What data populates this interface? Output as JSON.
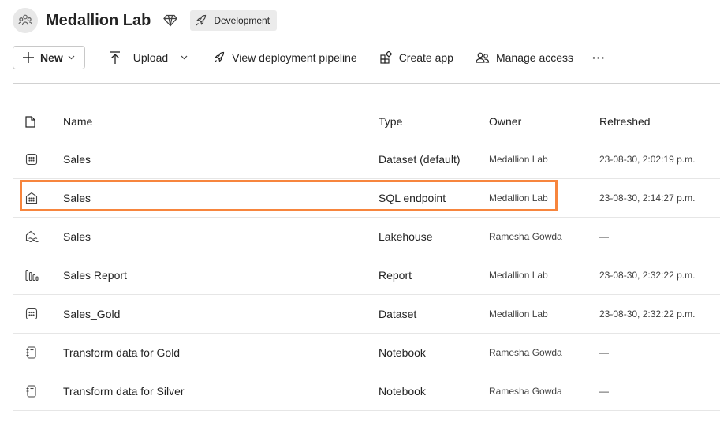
{
  "workspace": {
    "title": "Medallion Lab",
    "environment_badge": "Development",
    "avatar_icon": "workspace-people-icon",
    "premium_icon": "diamond-icon"
  },
  "toolbar": {
    "new_label": "New",
    "upload_label": "Upload",
    "pipeline_label": "View deployment pipeline",
    "create_app_label": "Create app",
    "manage_access_label": "Manage access",
    "more_label": "···"
  },
  "table": {
    "headers": {
      "name": "Name",
      "type": "Type",
      "owner": "Owner",
      "refreshed": "Refreshed"
    },
    "rows": [
      {
        "icon": "dataset-icon",
        "name": "Sales",
        "type": "Dataset (default)",
        "owner": "Medallion Lab",
        "refreshed": "23-08-30, 2:02:19 p.m."
      },
      {
        "icon": "sql-endpoint-icon",
        "name": "Sales",
        "type": "SQL endpoint",
        "owner": "Medallion Lab",
        "refreshed": "23-08-30, 2:14:27 p.m."
      },
      {
        "icon": "lakehouse-icon",
        "name": "Sales",
        "type": "Lakehouse",
        "owner": "Ramesha Gowda",
        "refreshed": "—"
      },
      {
        "icon": "report-icon",
        "name": "Sales Report",
        "type": "Report",
        "owner": "Medallion Lab",
        "refreshed": "23-08-30, 2:32:22 p.m."
      },
      {
        "icon": "dataset-icon",
        "name": "Sales_Gold",
        "type": "Dataset",
        "owner": "Medallion Lab",
        "refreshed": "23-08-30, 2:32:22 p.m."
      },
      {
        "icon": "notebook-icon",
        "name": "Transform data for Gold",
        "type": "Notebook",
        "owner": "Ramesha Gowda",
        "refreshed": "—"
      },
      {
        "icon": "notebook-icon",
        "name": "Transform data for Silver",
        "type": "Notebook",
        "owner": "Ramesha Gowda",
        "refreshed": "—"
      }
    ]
  },
  "colors": {
    "highlight": "#f7853d",
    "divider": "#d1d1d1"
  }
}
